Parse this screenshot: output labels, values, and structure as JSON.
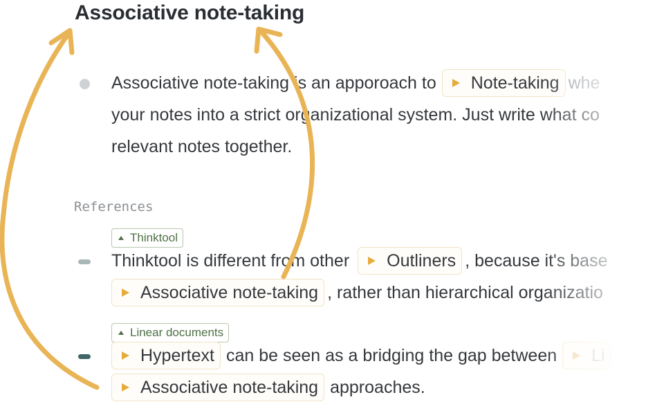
{
  "page": {
    "title": "Associative note-taking"
  },
  "paragraph": {
    "line1_pre": "Associative note-taking is an apporoach to",
    "link": "Note-taking",
    "line1_post": "whe",
    "line2": "your notes into a strict organizational system. Just write what co",
    "line3": "relevant notes together."
  },
  "references": {
    "heading": "References",
    "items": [
      {
        "tag": "Thinktool",
        "line1_pre": "Thinktool is different from other",
        "link1": "Outliners",
        "line1_post": ", because it's base",
        "link2": "Associative note-taking",
        "line2_post": ", rather than hierarchical organizatio"
      },
      {
        "tag": "Linear documents",
        "link1": "Hypertext",
        "line1_mid": "can be seen as a bridging the gap between",
        "link_ghost": "Li",
        "link2": "Associative note-taking",
        "line2_post": "approaches."
      }
    ]
  },
  "colors": {
    "accent": "#e6ab3a",
    "arrow": "#e9b455",
    "tag_green": "#4f7047",
    "bullet_grey": "#cfd2d4",
    "dash_light": "#a9b8b6",
    "dash_dark": "#3f6566"
  }
}
